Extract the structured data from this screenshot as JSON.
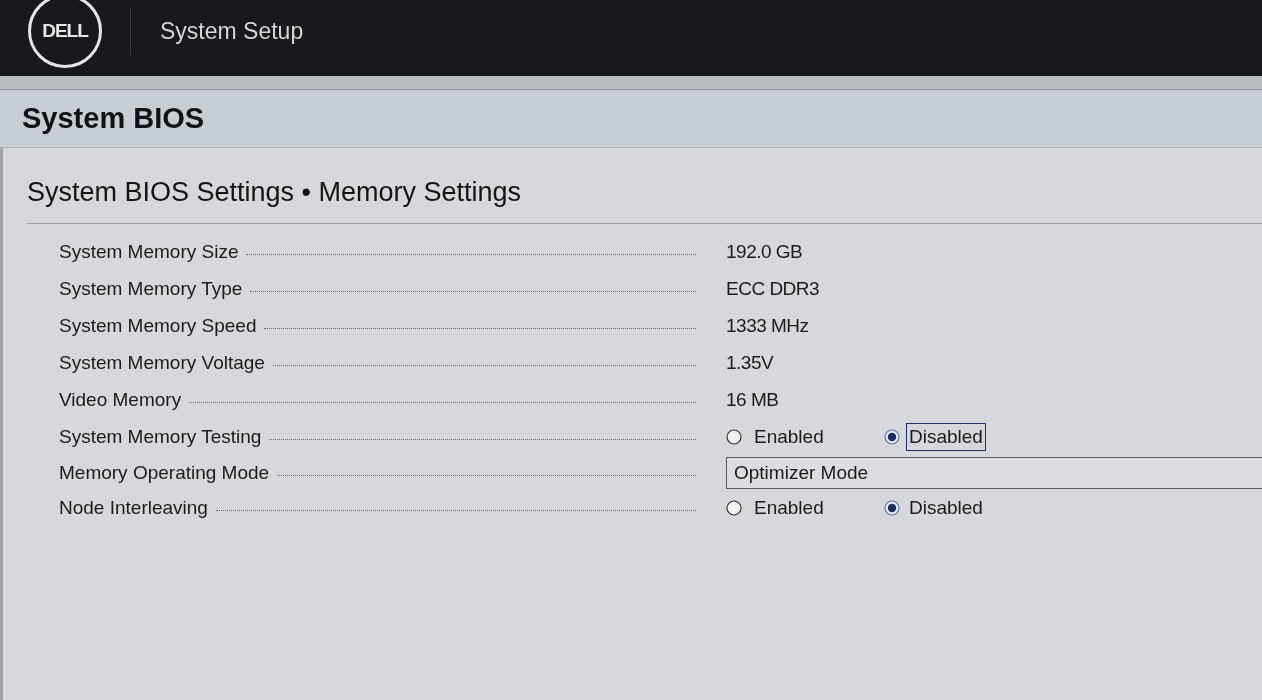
{
  "header": {
    "logo": "DELL",
    "title": "System Setup"
  },
  "page_title": "System BIOS",
  "breadcrumb": "System BIOS Settings • Memory Settings",
  "settings": [
    {
      "kind": "readonly",
      "label": "System Memory Size",
      "value": "192.0 GB"
    },
    {
      "kind": "readonly",
      "label": "System Memory Type",
      "value": "ECC DDR3"
    },
    {
      "kind": "readonly",
      "label": "System Memory Speed",
      "value": "1333 MHz"
    },
    {
      "kind": "readonly",
      "label": "System Memory Voltage",
      "value": "1.35V"
    },
    {
      "kind": "readonly",
      "label": "Video Memory",
      "value": "16 MB"
    },
    {
      "kind": "radio",
      "label": "System Memory Testing",
      "options": [
        {
          "label": "Enabled",
          "selected": false,
          "focused": false
        },
        {
          "label": "Disabled",
          "selected": true,
          "focused": true
        }
      ]
    },
    {
      "kind": "select",
      "label": "Memory Operating Mode",
      "value": "Optimizer Mode"
    },
    {
      "kind": "radio",
      "label": "Node Interleaving",
      "options": [
        {
          "label": "Enabled",
          "selected": false,
          "focused": false
        },
        {
          "label": "Disabled",
          "selected": true,
          "focused": false
        }
      ]
    }
  ]
}
